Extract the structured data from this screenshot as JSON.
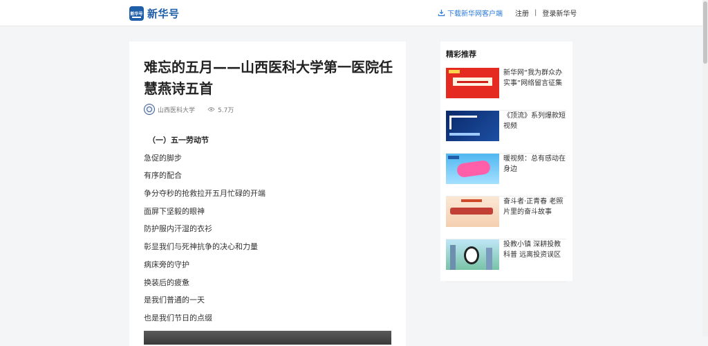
{
  "header": {
    "logo_mark_text": "新华号",
    "logo_text": "新华号",
    "download_label": "下载新华网客户端",
    "register_label": "注册",
    "separator": "|",
    "login_label": "登录新华号"
  },
  "article": {
    "title": "难忘的五月——山西医科大学第一医院任慧燕诗五首",
    "author": "山西医科大学",
    "views": "5.7万",
    "section_heading": "（一）五一劳动节",
    "lines": [
      "急促的脚步",
      "有序的配合",
      "争分夺秒的抢救拉开五月忙碌的开端",
      "面屏下坚毅的眼神",
      "防护服内汗湿的衣衫",
      "彰显我们与死神抗争的决心和力量",
      "病床旁的守护",
      "换装后的疲惫",
      "是我们普通的一天",
      "也是我们节日的点缀"
    ]
  },
  "sidebar": {
    "title": "精彩推荐",
    "items": [
      {
        "text": "新华网“我为群众办实事”网络留言征集"
      },
      {
        "text": "《顶流》系列爆款短视频"
      },
      {
        "text": "暖视频：总有感动在身边"
      },
      {
        "text": "奋斗者·正青春 老照片里的奋斗故事"
      },
      {
        "text": "投教小镇 深耕投教科普 远离投资误区"
      }
    ]
  }
}
